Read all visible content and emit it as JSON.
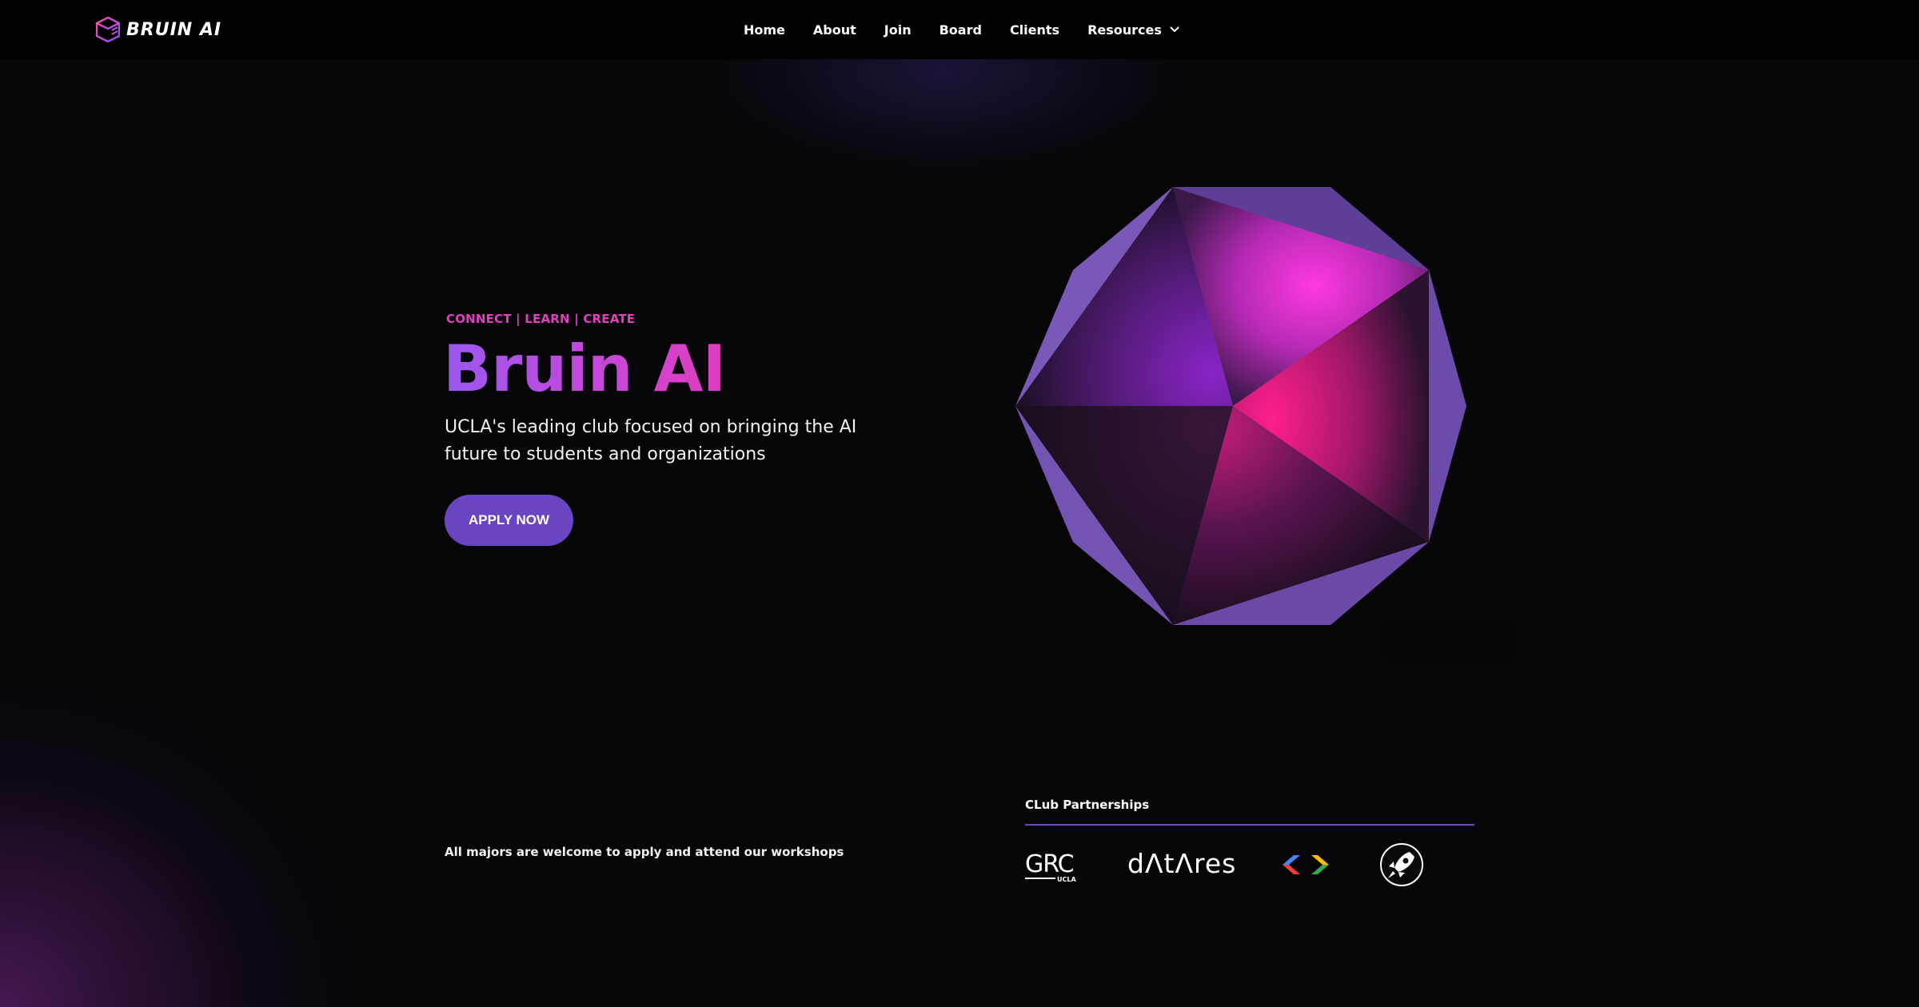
{
  "nav": {
    "logo_text": "BRUIN AI",
    "items": [
      {
        "label": "Home"
      },
      {
        "label": "About"
      },
      {
        "label": "Join"
      },
      {
        "label": "Board"
      },
      {
        "label": "Clients"
      },
      {
        "label": "Resources"
      }
    ]
  },
  "hero": {
    "tagline": "CONNECT | LEARN | CREATE",
    "title": "Bruin AI",
    "subtitle": "UCLA's leading club focused on bringing the AI future to students and organizations",
    "cta_label": "APPLY NOW"
  },
  "footer_note": "All majors are welcome to apply and attend our workshops",
  "partnerships": {
    "heading": "CLub Partnerships",
    "logos": [
      {
        "name": "GRC UCLA",
        "text": "GRC",
        "subtext": "UCLA"
      },
      {
        "name": "DataRes",
        "text": "dΛtΛres"
      },
      {
        "name": "code brackets logo",
        "icon": "code-brackets-icon"
      },
      {
        "name": "rocket logo",
        "icon": "rocket-icon"
      }
    ]
  },
  "colors": {
    "accent": "#6a45c2",
    "tagline": "#e040c0",
    "gradient_start": "#9a58f0",
    "gradient_end": "#e13cbe"
  }
}
